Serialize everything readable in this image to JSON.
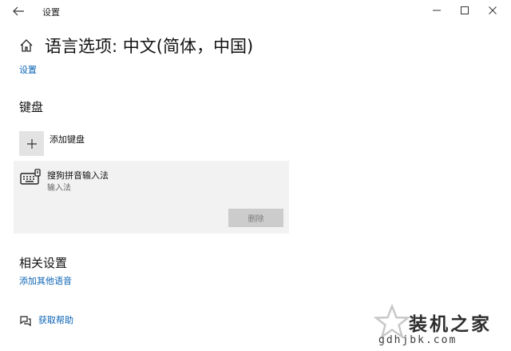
{
  "window": {
    "title": "设置",
    "back_icon": "arrow-left-icon",
    "controls": [
      "minimize-icon",
      "maximize-icon",
      "close-icon"
    ]
  },
  "header": {
    "home_icon": "home-icon",
    "title": "语言选项: 中文(简体，中国)"
  },
  "breadcrumb": {
    "settings_link": "设置"
  },
  "keyboard_section": {
    "title": "键盘",
    "add_keyboard_label": "添加键盘",
    "ime": {
      "name": "搜狗拼音输入法",
      "type": "输入法",
      "remove_label": "删除",
      "remove_enabled": false
    }
  },
  "related_section": {
    "title": "相关设置",
    "add_other_language_link": "添加其他语音"
  },
  "help": {
    "label": "获取帮助"
  },
  "watermark": {
    "text": "装机之家",
    "url": "gdhjbk.com"
  },
  "colors": {
    "link": "#0a63b5",
    "card_bg": "#f2f2f2",
    "button_disabled_bg": "#cccccc",
    "add_box_bg": "#e3e3e3"
  }
}
